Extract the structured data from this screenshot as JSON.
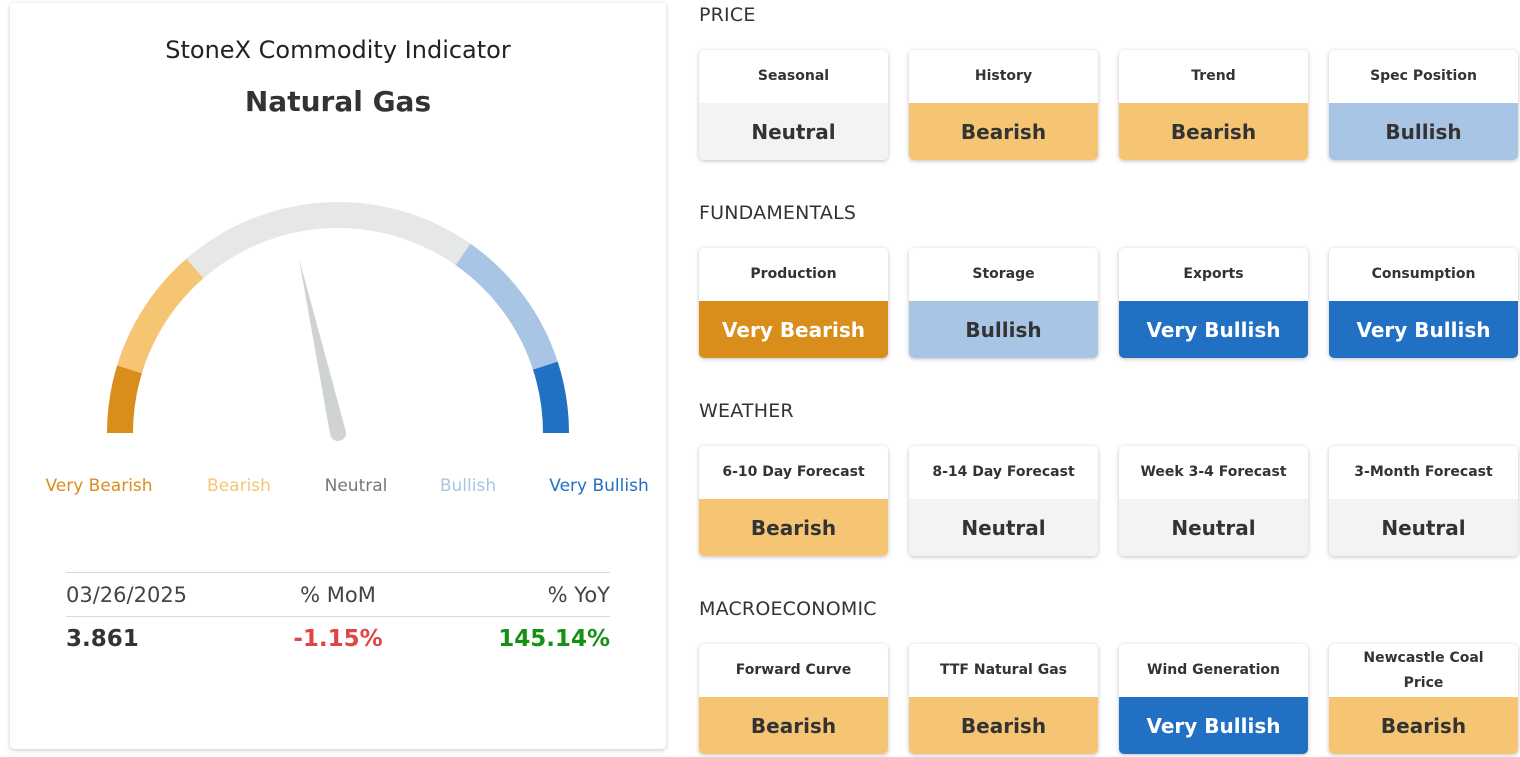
{
  "indicator": {
    "title": "StoneX Commodity Indicator",
    "commodity": "Natural Gas"
  },
  "gauge": {
    "level_fraction": 0.43,
    "scale": [
      {
        "label": "Very Bearish",
        "color": "#d98d1a"
      },
      {
        "label": "Bearish",
        "color": "#f6c574"
      },
      {
        "label": "Neutral",
        "color": "#777777"
      },
      {
        "label": "Bullish",
        "color": "#a8c5e6"
      },
      {
        "label": "Very Bullish",
        "color": "#2270c4"
      }
    ],
    "track_color": "#e6e7e7",
    "needle_color": "#d0d3d4"
  },
  "stats": {
    "date": "03/26/2025",
    "mom_label": "% MoM",
    "yoy_label": "% YoY",
    "price": "3.861",
    "mom_value": "-1.15%",
    "yoy_value": "145.14%",
    "mom_color": "#e04545",
    "yoy_color": "#149114"
  },
  "sentiment_styles": {
    "Neutral": {
      "bg": "#f2f3f3",
      "fg": "#333333"
    },
    "Bearish": {
      "bg": "#f6c574",
      "fg": "#333333"
    },
    "Very Bearish": {
      "bg": "#d98d1a",
      "fg": "#ffffff"
    },
    "Bullish": {
      "bg": "#a8c5e6",
      "fg": "#333333"
    },
    "Very Bullish": {
      "bg": "#2270c4",
      "fg": "#ffffff"
    }
  },
  "sections": [
    {
      "title": "PRICE",
      "tiles": [
        {
          "label": "Seasonal",
          "value": "Neutral"
        },
        {
          "label": "History",
          "value": "Bearish"
        },
        {
          "label": "Trend",
          "value": "Bearish"
        },
        {
          "label": "Spec Position",
          "value": "Bullish"
        }
      ]
    },
    {
      "title": "FUNDAMENTALS",
      "tiles": [
        {
          "label": "Production",
          "value": "Very Bearish"
        },
        {
          "label": "Storage",
          "value": "Bullish"
        },
        {
          "label": "Exports",
          "value": "Very Bullish"
        },
        {
          "label": "Consumption",
          "value": "Very Bullish"
        }
      ]
    },
    {
      "title": "WEATHER",
      "tiles": [
        {
          "label": "6-10 Day Forecast",
          "value": "Bearish"
        },
        {
          "label": "8-14 Day Forecast",
          "value": "Neutral"
        },
        {
          "label": "Week 3-4 Forecast",
          "value": "Neutral"
        },
        {
          "label": "3-Month Forecast",
          "value": "Neutral"
        }
      ]
    },
    {
      "title": "MACROECONOMIC",
      "tiles": [
        {
          "label": "Forward Curve",
          "value": "Bearish"
        },
        {
          "label": "TTF Natural Gas",
          "value": "Bearish"
        },
        {
          "label": "Wind Generation",
          "value": "Very Bullish"
        },
        {
          "label": "Newcastle Coal Price",
          "value": "Bearish"
        }
      ]
    }
  ]
}
